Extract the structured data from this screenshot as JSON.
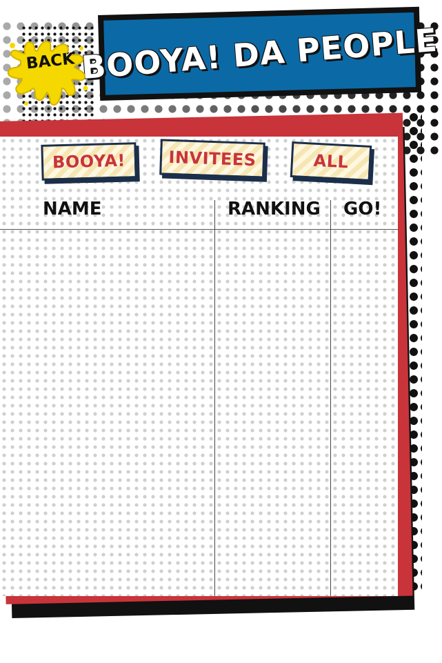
{
  "header": {
    "title": "BOOYA! DA PEOPLE",
    "back_label": "BACK"
  },
  "tabs": [
    {
      "label": "BOOYA!"
    },
    {
      "label": "INVITEES"
    },
    {
      "label": "ALL"
    }
  ],
  "table": {
    "columns": [
      "NAME",
      "RANKING",
      "GO!"
    ],
    "rows": []
  },
  "colors": {
    "banner_blue": "#0b6aa6",
    "frame_red": "#c8343a",
    "splat_yellow": "#f5d800",
    "tab_stripe": "#f6e6b4",
    "tab_border": "#1b2f4a"
  }
}
